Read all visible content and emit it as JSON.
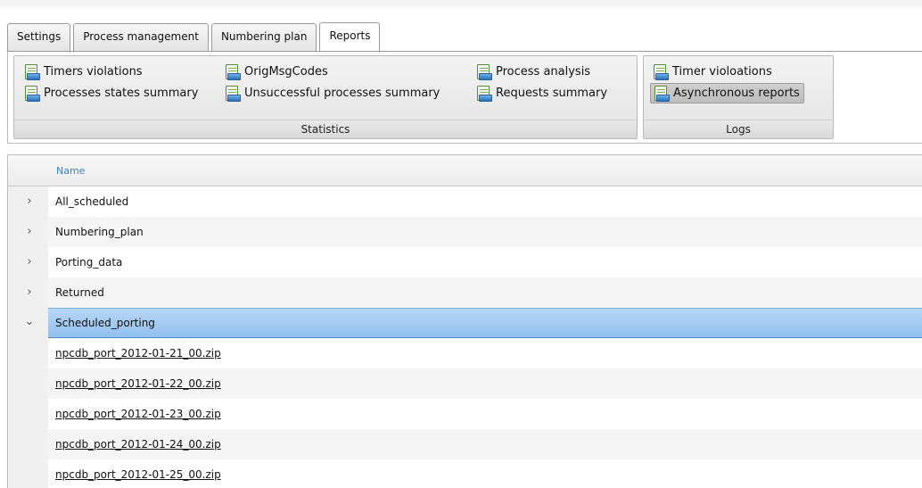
{
  "tabs": [
    {
      "label": "Settings"
    },
    {
      "label": "Process management"
    },
    {
      "label": "Numbering plan"
    },
    {
      "label": "Reports",
      "active": true
    }
  ],
  "ribbon": {
    "statistics": {
      "label": "Statistics",
      "items": [
        {
          "label": "Timers violations"
        },
        {
          "label": "Processes states summary"
        },
        {
          "label": "OrigMsgCodes"
        },
        {
          "label": "Unsuccessful processes summary"
        },
        {
          "label": "Process analysis"
        },
        {
          "label": "Requests summary"
        }
      ]
    },
    "logs": {
      "label": "Logs",
      "items": [
        {
          "label": "Timer violoations"
        },
        {
          "label": "Asynchronous reports",
          "selected": true
        }
      ]
    }
  },
  "grid": {
    "column_header": "Name",
    "folders": [
      {
        "name": "All_scheduled",
        "expanded": false
      },
      {
        "name": "Numbering_plan",
        "expanded": false
      },
      {
        "name": "Porting_data",
        "expanded": false
      },
      {
        "name": "Returned",
        "expanded": false
      },
      {
        "name": "Scheduled_porting",
        "expanded": true
      }
    ],
    "files": [
      "npcdb_port_2012-01-21_00.zip",
      "npcdb_port_2012-01-22_00.zip",
      "npcdb_port_2012-01-23_00.zip",
      "npcdb_port_2012-01-24_00.zip",
      "npcdb_port_2012-01-25_00.zip"
    ],
    "icons": {
      "collapsed": "chevron-right-icon",
      "expanded": "chevron-down-icon"
    }
  },
  "colors": {
    "selection": "#a6cbf2",
    "header_text": "#3a86c8",
    "alt_row": "#f5f5f5"
  }
}
